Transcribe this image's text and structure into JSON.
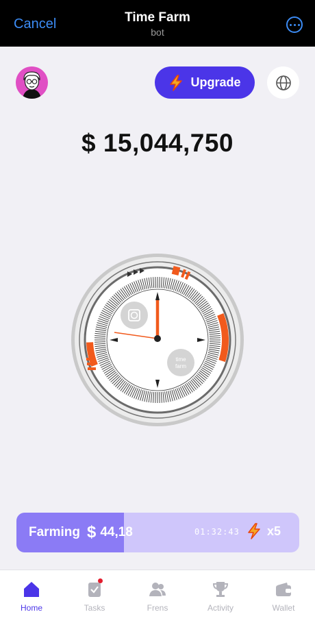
{
  "topbar": {
    "cancel_label": "Cancel",
    "title": "Time Farm",
    "subtitle": "bot"
  },
  "header": {
    "upgrade_label": "Upgrade"
  },
  "balance": {
    "text": "$ 15,044,750"
  },
  "clock": {
    "badge_text": "time farm"
  },
  "farming": {
    "label": "Farming",
    "currency": "$",
    "amount": "44,18",
    "timer": "01:32:43",
    "multiplier": "x5",
    "progress": 0.38
  },
  "nav": {
    "items": [
      {
        "label": "Home",
        "icon": "home-icon"
      },
      {
        "label": "Tasks",
        "icon": "tasks-icon"
      },
      {
        "label": "Frens",
        "icon": "frens-icon"
      },
      {
        "label": "Activity",
        "icon": "trophy-icon"
      },
      {
        "label": "Wallet",
        "icon": "wallet-icon"
      }
    ]
  },
  "colors": {
    "accent": "#4b35e8",
    "orange": "#f15a1c",
    "link": "#3c8cf5",
    "farm_fill": "#8b7bf5"
  }
}
